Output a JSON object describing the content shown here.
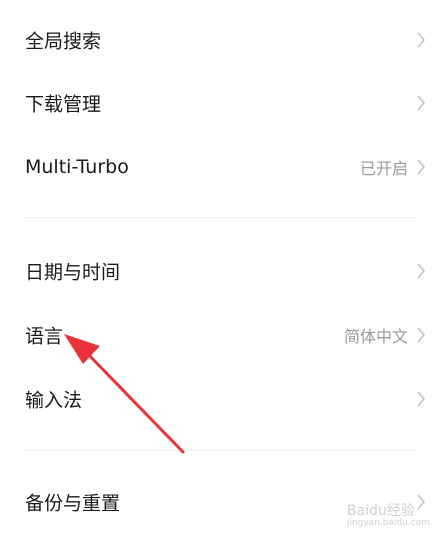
{
  "settings": {
    "group1": [
      {
        "label": "全局搜索",
        "value": ""
      },
      {
        "label": "下载管理",
        "value": ""
      },
      {
        "label": "Multi-Turbo",
        "value": "已开启"
      }
    ],
    "group2": [
      {
        "label": "日期与时间",
        "value": ""
      },
      {
        "label": "语言",
        "value": "简体中文"
      },
      {
        "label": "输入法",
        "value": ""
      }
    ],
    "group3": [
      {
        "label": "备份与重置",
        "value": ""
      }
    ]
  },
  "annotation": {
    "arrow_color": "#e8333a"
  },
  "watermark": {
    "text": "Baidu经验",
    "sub": "jingyan.baidu.com"
  }
}
